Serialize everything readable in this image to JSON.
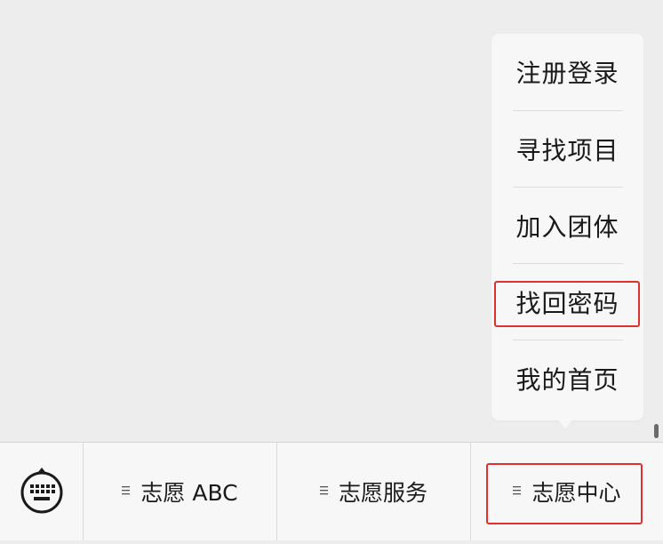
{
  "popup_menu": {
    "items": [
      {
        "label": "注册登录"
      },
      {
        "label": "寻找项目"
      },
      {
        "label": "加入团体"
      },
      {
        "label": "找回密码"
      },
      {
        "label": "我的首页"
      }
    ],
    "highlighted_item": "找回密码"
  },
  "bottom_bar": {
    "keyboard_icon": "keyboard-icon",
    "tabs": [
      {
        "label": "志愿 ABC",
        "icon": "menu-lines-icon"
      },
      {
        "label": "志愿服务",
        "icon": "menu-lines-icon"
      },
      {
        "label": "志愿中心",
        "icon": "menu-lines-icon"
      }
    ],
    "highlighted_tab": "志愿中心"
  },
  "colors": {
    "background": "#ededed",
    "menu_background": "#f7f7f7",
    "highlight": "#e03131",
    "text": "#1a1a1a"
  }
}
